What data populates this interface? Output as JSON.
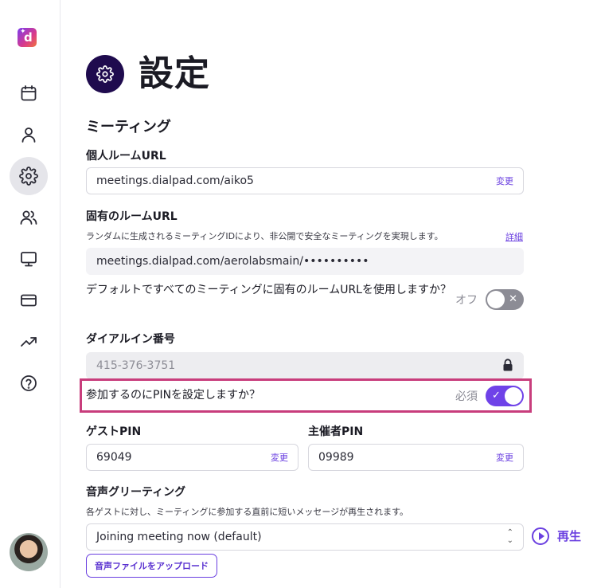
{
  "sidebar": {
    "logo_letter": "d",
    "items": [
      {
        "icon": "calendar-icon"
      },
      {
        "icon": "user-icon"
      },
      {
        "icon": "gear-icon",
        "active": true
      },
      {
        "icon": "users-icon"
      },
      {
        "icon": "monitor-icon"
      },
      {
        "icon": "credit-card-icon"
      },
      {
        "icon": "trending-up-icon"
      },
      {
        "icon": "help-icon"
      }
    ]
  },
  "header": {
    "title": "設定"
  },
  "meeting": {
    "section_title": "ミーティング",
    "personal_room": {
      "label": "個人ルームURL",
      "value": "meetings.dialpad.com/aiko5",
      "action": "変更"
    },
    "unique_room": {
      "label": "固有のルームURL",
      "description": "ランダムに生成されるミーティングIDにより、非公開で安全なミーティングを実現します。",
      "details_link": "詳細",
      "value": "meetings.dialpad.com/aerolabsmain/••••••••••"
    },
    "default_unique": {
      "question": "デフォルトですべてのミーティングに固有のルームURLを使用しますか？",
      "state_label": "オフ",
      "enabled": false
    },
    "dial_in": {
      "label": "ダイアルイン番号",
      "value": "415-376-3751"
    },
    "pin_required": {
      "question": "参加するのにPINを設定しますか？",
      "state_label": "必須",
      "enabled": true
    },
    "guest_pin": {
      "label": "ゲストPIN",
      "value": "69049",
      "action": "変更"
    },
    "host_pin": {
      "label": "主催者PIN",
      "value": "09989",
      "action": "変更"
    },
    "greeting": {
      "label": "音声グリーティング",
      "description": "各ゲストに対し、ミーティングに参加する直前に短いメッセージが再生されます。",
      "selected": "Joining meeting now (default)",
      "play_label": "再生",
      "upload_label": "音声ファイルをアップロード"
    }
  },
  "colors": {
    "accent": "#6f42e8",
    "highlight": "#c83d7c",
    "title_icon_bg": "#1f0b4e"
  }
}
